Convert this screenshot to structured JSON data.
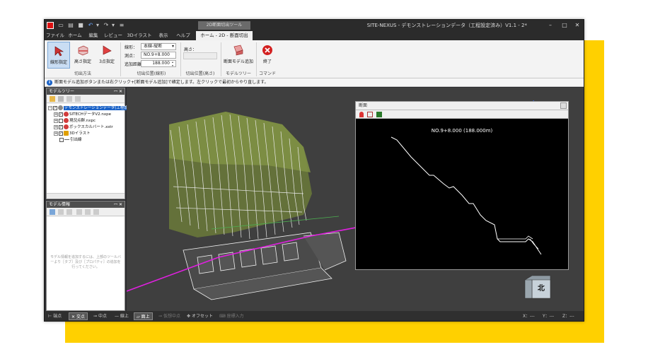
{
  "window": {
    "title": "SITE-NEXUS - デモンストレーションデータ（工程設定済み）V1.1 - 2*",
    "context_tab_group": "2D断面切出ツール"
  },
  "tabs": [
    {
      "label": "ファイル",
      "active": false
    },
    {
      "label": "ホーム",
      "active": false
    },
    {
      "label": "編集",
      "active": false
    },
    {
      "label": "レビュー",
      "active": false
    },
    {
      "label": "3Dイラスト",
      "active": false
    },
    {
      "label": "表示",
      "active": false
    },
    {
      "label": "ヘルプ",
      "active": false
    },
    {
      "label": "ホーム - 2D - 断面切出",
      "active": true
    }
  ],
  "ribbon": {
    "cut_method": {
      "label": "切出方法",
      "buttons": [
        {
          "label": "線形指定",
          "icon": "linear-select-icon",
          "selected": true
        },
        {
          "label": "高さ指定",
          "icon": "height-select-icon",
          "selected": false
        },
        {
          "label": "3点指定",
          "icon": "three-point-icon",
          "selected": false
        }
      ]
    },
    "cut_position": {
      "label": "切出位置(線形)",
      "alignment_label": "線形：",
      "alignment_value": "本線-縦断",
      "station_label": "測点：",
      "station_value": "NO.9+8.000",
      "add_distance_label": "追加距離：",
      "add_distance_value": "188.000"
    },
    "cut_height": {
      "label": "切出位置(高さ)",
      "height_label": "高さ：",
      "height_value": ""
    },
    "model_tree_group": {
      "label": "モデルツリー",
      "button": "断面モデル追加"
    },
    "command_group": {
      "label": "コマンド",
      "button": "終了"
    }
  },
  "message": "断面モデル追加ボタンまたは右クリック+[断面モデル追加]で確定します。左クリックで最初からやり直します。",
  "model_tree": {
    "title": "モデルツリー",
    "items": [
      {
        "label": "デモンストレーションデータ(工程設",
        "level": 0,
        "selected": true,
        "checked": true,
        "icon_color": "#888888"
      },
      {
        "label": "SITECHデータV2.nxpe",
        "level": 1,
        "selected": false,
        "checked": true,
        "icon_color": "#d23c3c"
      },
      {
        "label": "現況点群.nxpc",
        "level": 1,
        "selected": false,
        "checked": false,
        "icon_color": "#d23c3c"
      },
      {
        "label": "ボックスカルバート.xstr",
        "level": 1,
        "selected": false,
        "checked": true,
        "icon_color": "#d23c3c"
      },
      {
        "label": "3Dイラスト",
        "level": 1,
        "selected": false,
        "checked": true,
        "icon_color": "#e0a000"
      },
      {
        "label": "引出線",
        "level": 1,
        "selected": false,
        "checked": false,
        "icon_color": "#666666"
      }
    ]
  },
  "model_info": {
    "title": "モデル情報",
    "hint": "モデル情報を追加するには、上部のツールバーより［タブ］及び［プロパティ］の追加を行ってください。"
  },
  "section_window": {
    "title": "断面",
    "station_label": "NO.9+8.000 (188.000m)"
  },
  "view_cube": {
    "face_label": "北"
  },
  "status": {
    "snaps": [
      {
        "label": "端点",
        "on": false,
        "dim": false
      },
      {
        "label": "交点",
        "on": true,
        "dim": false
      },
      {
        "label": "中点",
        "on": false,
        "dim": false
      },
      {
        "label": "線上",
        "on": false,
        "dim": false
      },
      {
        "label": "面上",
        "on": true,
        "dim": false
      },
      {
        "label": "仮想中点",
        "on": false,
        "dim": true
      },
      {
        "label": "オフセット",
        "on": false,
        "dim": false
      },
      {
        "label": "座標入力",
        "on": false,
        "dim": true
      }
    ],
    "x": "X：---",
    "y": "Y：---",
    "z": "Z：---"
  },
  "colors": {
    "accent": "#1a62c7",
    "yellow_backdrop": "#ffd000",
    "dark_chrome": "#2b2b2b",
    "magenta_line": "#e020e0"
  }
}
